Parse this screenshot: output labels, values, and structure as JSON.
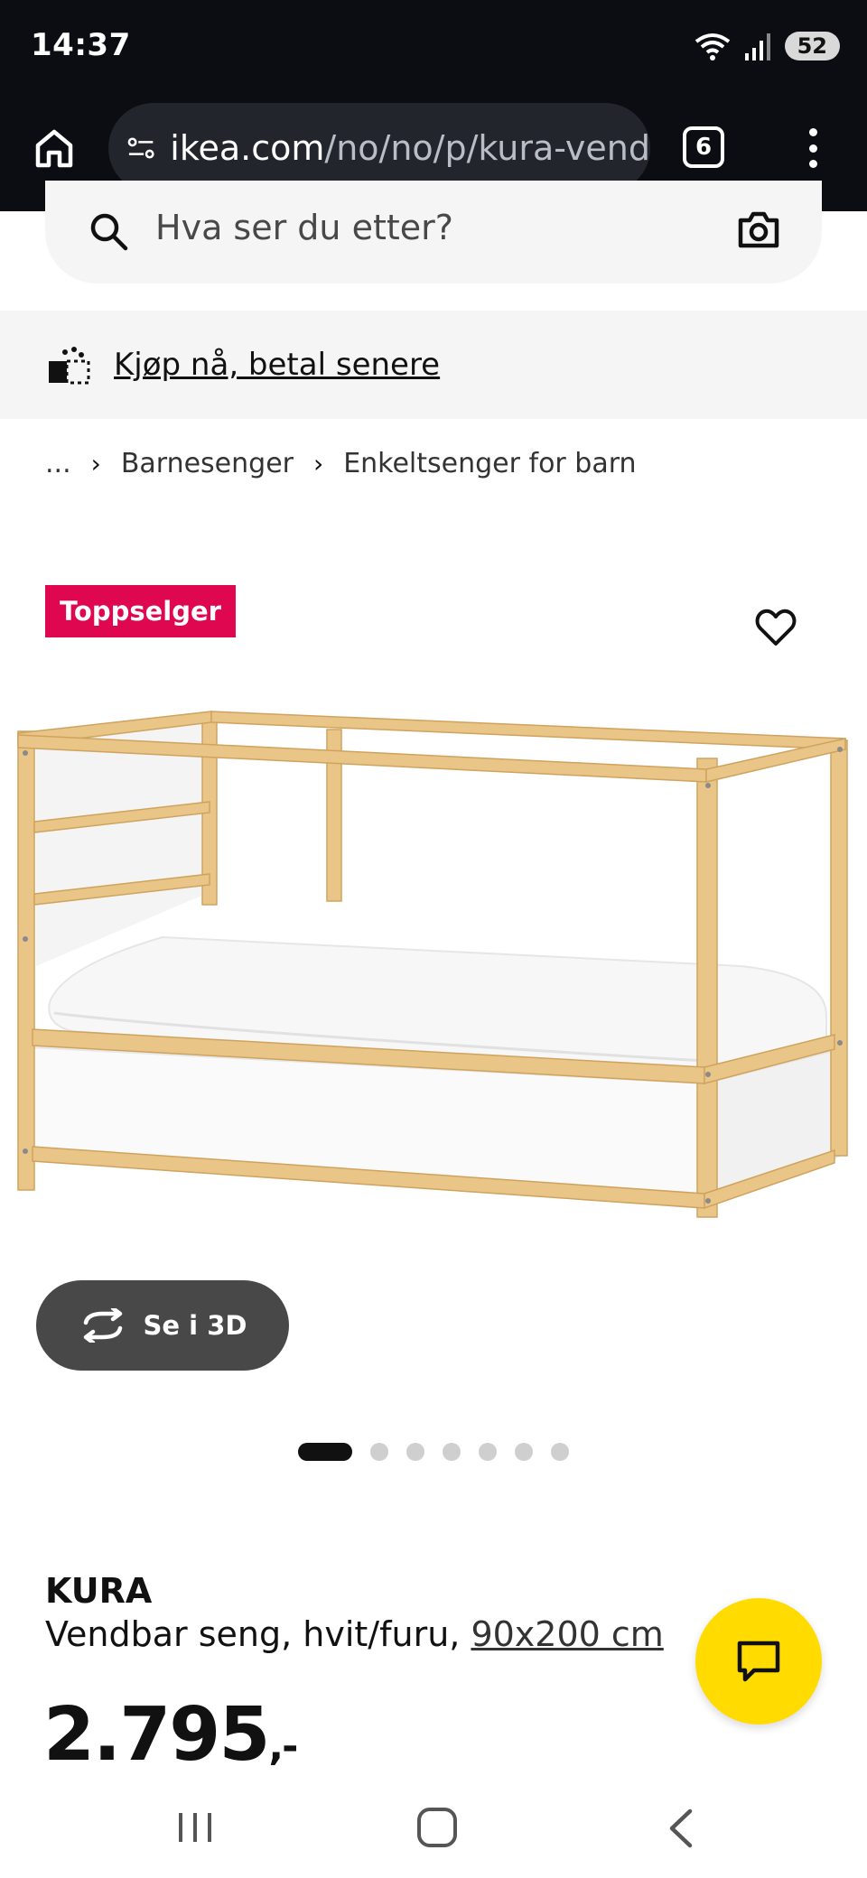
{
  "status_bar": {
    "time": "14:37",
    "battery": "52"
  },
  "browser": {
    "url_domain": "ikea.com",
    "url_path": "/no/no/p/kura-vend",
    "tab_count": "6"
  },
  "search": {
    "placeholder": "Hva ser du etter?"
  },
  "banner": {
    "bnpl_label": "Kjøp nå, betal senere"
  },
  "breadcrumb": {
    "items": [
      "...",
      "Barnesenger",
      "Enkeltsenger for barn"
    ]
  },
  "product": {
    "badge": "Toppselger",
    "view_3d_label": "Se i 3D",
    "carousel": {
      "total": 7,
      "active_index": 0
    },
    "name": "KURA",
    "description": "Vendbar seng, hvit/furu, ",
    "size": "90x200 cm",
    "price": "2.795",
    "price_suffix": ",-"
  },
  "colors": {
    "badge": "#e00751",
    "chat_fab": "#ffdb00",
    "wood": "#e9c587",
    "dark_button": "#484848"
  },
  "icons": [
    "home-icon",
    "site-settings-icon",
    "tabs-icon",
    "overflow-menu-icon",
    "search-icon",
    "camera-icon",
    "bnpl-icon",
    "heart-icon",
    "rotate-3d-icon",
    "chat-icon",
    "nav-recent-icon",
    "nav-home-icon",
    "nav-back-icon"
  ]
}
